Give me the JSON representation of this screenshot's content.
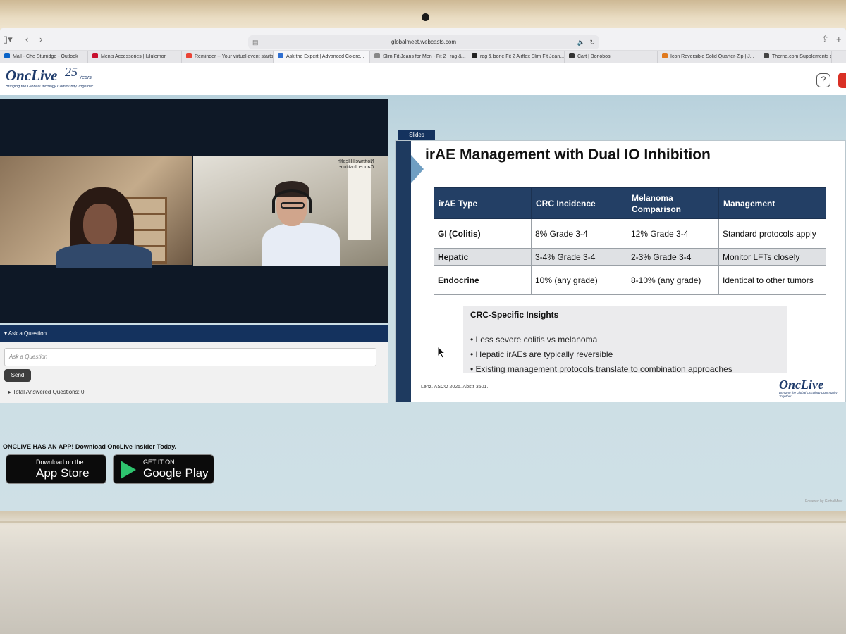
{
  "browser": {
    "url": "globalmeet.webcasts.com",
    "tabs": [
      {
        "label": "Mail - Che Sturridge - Outlook",
        "color": "#0a64c8"
      },
      {
        "label": "Men's Accessories | lululemon",
        "color": "#c8102e"
      },
      {
        "label": "Reminder -- Your virtual event starts...",
        "color": "#ea4335"
      },
      {
        "label": "Ask the Expert | Advanced Colore...",
        "color": "#2f6fd1",
        "active": true
      },
      {
        "label": "Slim Fit Jeans for Men - Fit 2 | rag &...",
        "color": "#888888"
      },
      {
        "label": "rag & bone Fit 2 Airflex Slim Fit Jean...",
        "color": "#222222"
      },
      {
        "label": "Cart | Bonobos",
        "color": "#333333"
      },
      {
        "label": "Icon Reversible Solid Quarter-Zip | J...",
        "color": "#e07a1f"
      },
      {
        "label": "Thorne.com Supplements and",
        "color": "#444444"
      }
    ]
  },
  "header": {
    "logo": "OncLive",
    "logo_years": "25",
    "logo_years_label": "Years",
    "logo_tagline": "Bringing the Global Oncology Community Together",
    "help": "?"
  },
  "video": {
    "presenter_logo_line1": "Northwell Health",
    "presenter_logo_line2": "Cancer Institute"
  },
  "ask": {
    "header": "Ask a Question",
    "placeholder": "Ask a Question",
    "send": "Send",
    "answered_label": "Total Answered Questions:",
    "answered_count": "0"
  },
  "promo": {
    "text": "ONCLIVE HAS AN APP! Download OncLive Insider Today.",
    "appstore_small": "Download on the",
    "appstore_big": "App Store",
    "googleplay_small": "GET IT ON",
    "googleplay_big": "Google Play"
  },
  "slides": {
    "tab": "Slides",
    "title": "irAE Management with Dual IO Inhibition",
    "table": {
      "headers": [
        "irAE Type",
        "CRC Incidence",
        "Melanoma Comparison",
        "Management"
      ],
      "rows": [
        [
          "GI (Colitis)",
          "8% Grade 3-4",
          "12% Grade 3-4",
          "Standard protocols apply"
        ],
        [
          "Hepatic",
          "3-4% Grade 3-4",
          "2-3% Grade 3-4",
          "Monitor LFTs closely"
        ],
        [
          "Endocrine",
          "10% (any grade)",
          "8-10% (any grade)",
          "Identical to other tumors"
        ]
      ]
    },
    "insights_title": "CRC-Specific Insights",
    "insights": [
      "• Less severe colitis vs melanoma",
      "• Hepatic irAEs are typically reversible",
      "• Existing management protocols translate to combination approaches"
    ],
    "reference": "Lenz. ASCO 2025. Abstr 3501.",
    "logo": "OncLive",
    "logo_tagline": "Bringing the Global Oncology Community Together"
  },
  "powered_by": "Powered by GlobalMeet"
}
